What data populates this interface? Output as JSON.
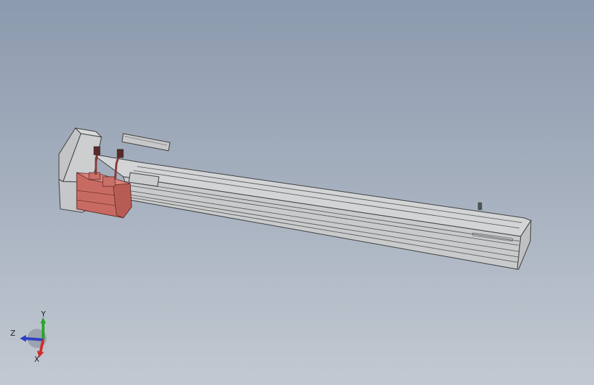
{
  "viewport": {
    "background_top": "#8c9aae",
    "background_bottom": "#c3c9d2"
  },
  "model": {
    "name": "linear-module-with-servo-motor",
    "body_color": "#cfd0d2",
    "edge_color": "#3a3a3a",
    "motor_color": "#c76b62",
    "cable_color": "#8a3a36"
  },
  "triad": {
    "x_label": "X",
    "y_label": "Y",
    "z_label": "Z",
    "x_color": "#d22b2b",
    "y_color": "#2aa52a",
    "z_color": "#2c3fc4"
  }
}
